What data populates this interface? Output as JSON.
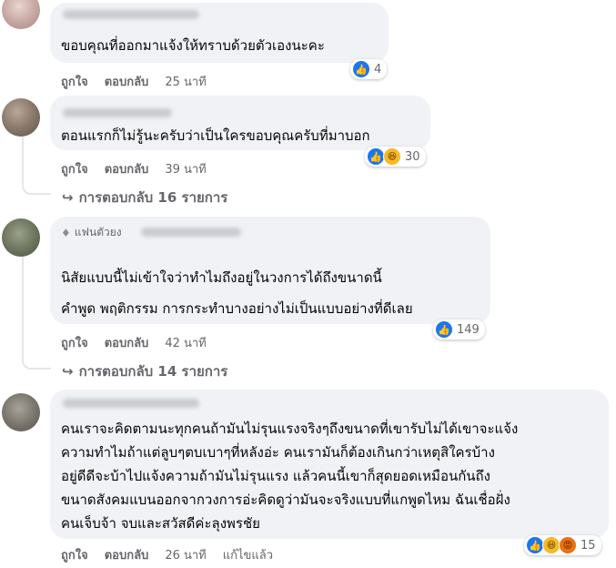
{
  "actions": {
    "like": "ถูกใจ",
    "reply": "ตอบกลับ",
    "edited": "แก้ไขแล้ว"
  },
  "comments": [
    {
      "lines": [
        "ขอบคุณที่ออกมาแจ้งให้ทราบด้วยตัวเองนะคะ"
      ],
      "time": "25 นาที",
      "reactions": [
        "like"
      ],
      "reaction_count": "4"
    },
    {
      "lines": [
        "ตอนแรกก็ไม่รู้นะครับว่าเป็นใครขอบคุณครับที่มาบอก"
      ],
      "time": "39 นาที",
      "reactions": [
        "like",
        "haha"
      ],
      "reaction_count": "30",
      "replies": "การตอบกลับ 16 รายการ"
    },
    {
      "badge": "แฟนตัวยง",
      "lines": [
        "นิสัยแบบนี้ไม่เข้าใจว่าทำไมถึงอยู่ในวงการได้ถึงขนาดนี้",
        "คำพูด พฤติกรรม การกระทำบางอย่างไม่เป็นแบบอย่างที่ดีเลย"
      ],
      "time": "42 นาที",
      "reactions": [
        "like"
      ],
      "reaction_count": "149",
      "replies": "การตอบกลับ 14 รายการ"
    },
    {
      "lines": [
        "คนเราจะคิดตามนะทุกคนถ้ามันไม่รุนแรงจริงๆถึงขนาดที่เขารับไม่ได้เขาจะแจ้ง",
        "ความทำไมถ้าแต่ลูบๆตบเบาๆที่หลังอ่ะ คนเรามันก็ต้องเกินกว่าเหตุสิใครบ้าง",
        "อยู่ดีดีจะบ้าไปแจ้งความถ้ามันไม่รุนแรง แล้วคนนี้เขาก็สุดยอดเหมือนกันถึง",
        "ขนาดสังคมแบนออกจากวงการอ่ะคิดดูว่ามันจะจริงแบบที่แกพูดไหม ฉันเชื่อฝั่ง",
        "คนเจ็บจ้า จบและสวัสดีค่ะลุงพรชัย"
      ],
      "time": "26 นาที",
      "edited": true,
      "reactions": [
        "like",
        "haha",
        "angry"
      ],
      "reaction_count": "15"
    }
  ],
  "colors": {
    "bubble": "#f0f2f5",
    "meta": "#65676b",
    "like": "#1877f2"
  }
}
